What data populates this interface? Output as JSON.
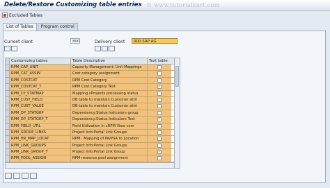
{
  "window": {
    "title": "Delete/Restore Customizing table entries",
    "watermark": "© www.tutorialkart.com"
  },
  "toolbar": {
    "excluded_tables_label": "Excluded Tables",
    "excluded_tables_icon": "delete-table-icon"
  },
  "tabs": [
    {
      "label": "List of Tables",
      "active": true
    },
    {
      "label": "Program control",
      "active": false
    }
  ],
  "fields": {
    "current_client_label": "Current client",
    "current_client_value": "800",
    "delivery_client_label": "Delivery client",
    "delivery_client_value": "000 SAP AG"
  },
  "table": {
    "headers": [
      "Customizing tables",
      "Table Description",
      "Text table"
    ],
    "rows": [
      {
        "name": "RPM_CAP_UNIT",
        "desc": "Capacity Management: Unit Mappings",
        "text": false
      },
      {
        "name": "RPM_CAT_ASSIN",
        "desc": "Cost category assignment",
        "text": false
      },
      {
        "name": "RPM_COSTCAT",
        "desc": "RPM Cost Category",
        "text": false
      },
      {
        "name": "RPM_COSTCAT_T",
        "desc": "RPM Cost Category Text",
        "text": true
      },
      {
        "name": "RPM_CP_STATMAP",
        "desc": "Mapping cProjects processing status",
        "text": false
      },
      {
        "name": "RPM_CUST_FIELD",
        "desc": "DB table to maintain Customer attri",
        "text": false
      },
      {
        "name": "RPM_CUST_VALUE",
        "desc": "DB table to maintain Customer attri",
        "text": false
      },
      {
        "name": "RPM_DP_STATGRP",
        "desc": "Dependency:Status Indicators group",
        "text": false
      },
      {
        "name": "RPM_DP_STATGRP_T",
        "desc": "Dependency:Status Indicators Text",
        "text": true
      },
      {
        "name": "RPM_FIELD_UTIL",
        "desc": "Field Utilization in xRPM View com",
        "text": false
      },
      {
        "name": "RPM_GROUP_LINKS",
        "desc": "Project Info:Portal Link Groups",
        "text": false
      },
      {
        "name": "RPM_HR_MAP_LOCAT",
        "desc": "RPM : Mapping of PA/PSA to Location",
        "text": false
      },
      {
        "name": "RPM_LINK_GROUPS",
        "desc": "Project Info:Portal Link Groups",
        "text": false
      },
      {
        "name": "RPM_LINK_GROUP_T",
        "desc": "Project Info:Portal Link Group",
        "text": true
      },
      {
        "name": "RPM_POOL_ASSIGN",
        "desc": "RPM resource pool assignment",
        "text": false
      }
    ]
  }
}
